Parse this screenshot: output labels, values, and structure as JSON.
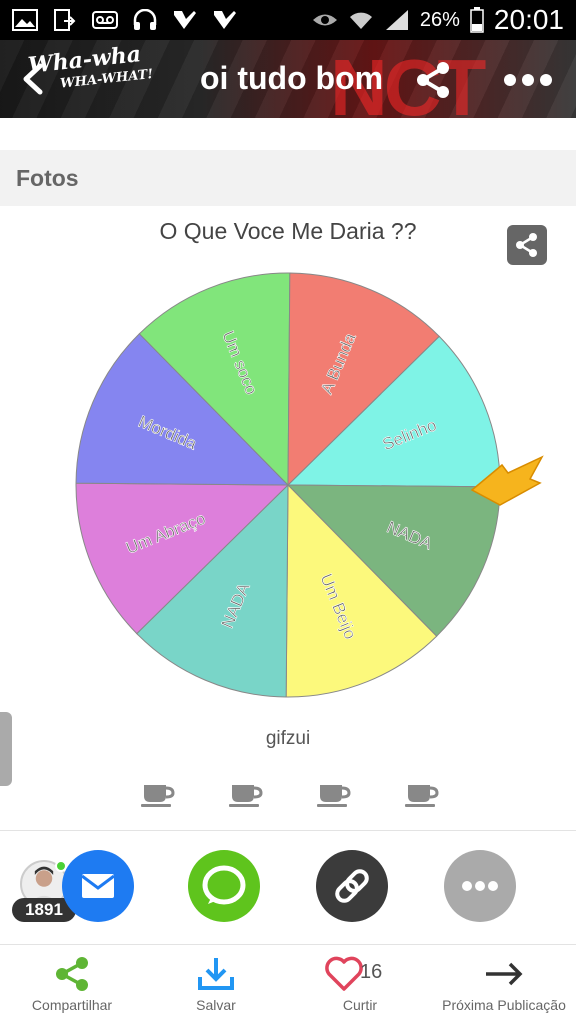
{
  "status_bar": {
    "battery_percent": "26%",
    "time": "20:01",
    "icons": [
      "image-icon",
      "share-arrow-icon",
      "voicemail-icon",
      "headphones-icon",
      "check-badge-icon",
      "check-badge-icon",
      "eye-icon",
      "wifi-icon",
      "signal-icon",
      "battery-icon"
    ]
  },
  "header": {
    "title": "oi tudo bom",
    "logo_text_1": "Wha-wha",
    "logo_text_2": "WHA-WHAT!",
    "logo_text_3": "",
    "bg_brand": "NCT",
    "icons": [
      "back-chevron-icon",
      "share-icon",
      "more-icon"
    ]
  },
  "section": {
    "label": "Fotos"
  },
  "wheel": {
    "title": "O Que Voce Me Daria ??",
    "caption": "gifzui",
    "segments": [
      {
        "label": "Selinho",
        "color": "#7ff3e6"
      },
      {
        "label": "NADA",
        "color": "#7bb57f"
      },
      {
        "label": "Um Beijo",
        "color": "#fcf97c"
      },
      {
        "label": "NADA",
        "color": "#79d5c8"
      },
      {
        "label": "Um Abraço",
        "color": "#dd7fdb"
      },
      {
        "label": "Mordida",
        "color": "#8585f0"
      },
      {
        "label": "Um soco",
        "color": "#81e57b"
      },
      {
        "label": "A Bunda",
        "color": "#f27d72"
      }
    ],
    "pointer_color": "#f6b41d"
  },
  "reactions": {
    "cup_count": 4
  },
  "share_row": {
    "badge_count": "1891",
    "buttons": [
      "mail-icon",
      "message-icon",
      "link-icon",
      "more-icon"
    ],
    "colors": {
      "mail": "#1e7bf2",
      "message": "#5fc41d",
      "link": "#3b3b3b",
      "more": "#aaaaaa"
    }
  },
  "bottom_nav": {
    "share_label": "Compartilhar",
    "save_label": "Salvar",
    "like_label": "Curtir",
    "like_count": "16",
    "next_label": "Próxima Publicação",
    "colors": {
      "share": "#5fb535",
      "save": "#2196f3",
      "like": "#e0445c"
    }
  }
}
